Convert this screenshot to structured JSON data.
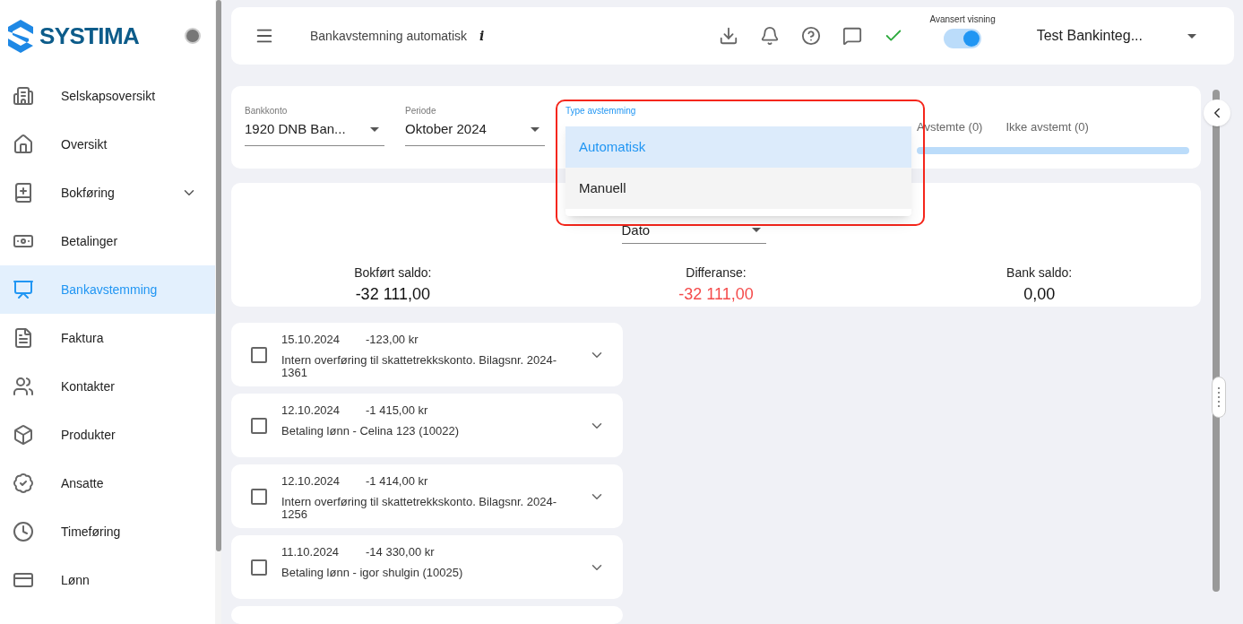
{
  "logo": {
    "text": "SYSTIMA"
  },
  "sidebar": {
    "items": [
      {
        "label": "Selskapsoversikt",
        "selected": false,
        "expandable": false
      },
      {
        "label": "Oversikt",
        "selected": false,
        "expandable": false
      },
      {
        "label": "Bokføring",
        "selected": false,
        "expandable": true
      },
      {
        "label": "Betalinger",
        "selected": false,
        "expandable": false
      },
      {
        "label": "Bankavstemming",
        "selected": true,
        "expandable": false
      },
      {
        "label": "Faktura",
        "selected": false,
        "expandable": false
      },
      {
        "label": "Kontakter",
        "selected": false,
        "expandable": false
      },
      {
        "label": "Produkter",
        "selected": false,
        "expandable": false
      },
      {
        "label": "Ansatte",
        "selected": false,
        "expandable": false
      },
      {
        "label": "Timeføring",
        "selected": false,
        "expandable": false
      },
      {
        "label": "Lønn",
        "selected": false,
        "expandable": false
      }
    ]
  },
  "header": {
    "title": "Bankavstemning automatisk",
    "info": "i",
    "toggle_label": "Avansert visning",
    "toggle_on": true,
    "company": "Test Bankinteg..."
  },
  "filters": {
    "bankkonto": {
      "label": "Bankkonto",
      "value": "1920 DNB Ban..."
    },
    "periode": {
      "label": "Periode",
      "value": "Oktober 2024"
    },
    "type": {
      "label": "Type avstemming"
    },
    "tabs": [
      {
        "label": "Avstemte (0)",
        "selected": false
      },
      {
        "label": "Ikke avstemt (0)",
        "selected": false
      }
    ]
  },
  "type_menu": {
    "options": [
      {
        "label": "Automatisk",
        "selected": true
      },
      {
        "label": "Manuell",
        "selected": false
      }
    ]
  },
  "summary": {
    "sort": {
      "value": "Dato"
    },
    "totals": [
      {
        "label": "Bokført saldo:",
        "value": "-32 111,00",
        "negative_highlight": false
      },
      {
        "label": "Differanse:",
        "value": "-32 111,00",
        "negative_highlight": true
      },
      {
        "label": "Bank saldo:",
        "value": "0,00",
        "negative_highlight": false
      }
    ]
  },
  "transactions": [
    {
      "date": "15.10.2024",
      "amount": "-123,00 kr",
      "text": "Intern overføring til skattetrekkskonto. Bilagsnr. 2024-1361",
      "checked": false
    },
    {
      "date": "12.10.2024",
      "amount": "-1 415,00 kr",
      "text": "Betaling lønn - Celina 123 (10022)",
      "checked": false
    },
    {
      "date": "12.10.2024",
      "amount": "-1 414,00 kr",
      "text": "Intern overføring til skattetrekkskonto. Bilagsnr. 2024-1256",
      "checked": false
    },
    {
      "date": "11.10.2024",
      "amount": "-14 330,00 kr",
      "text": "Betaling lønn - igor shulgin (10025)",
      "checked": false
    }
  ]
}
